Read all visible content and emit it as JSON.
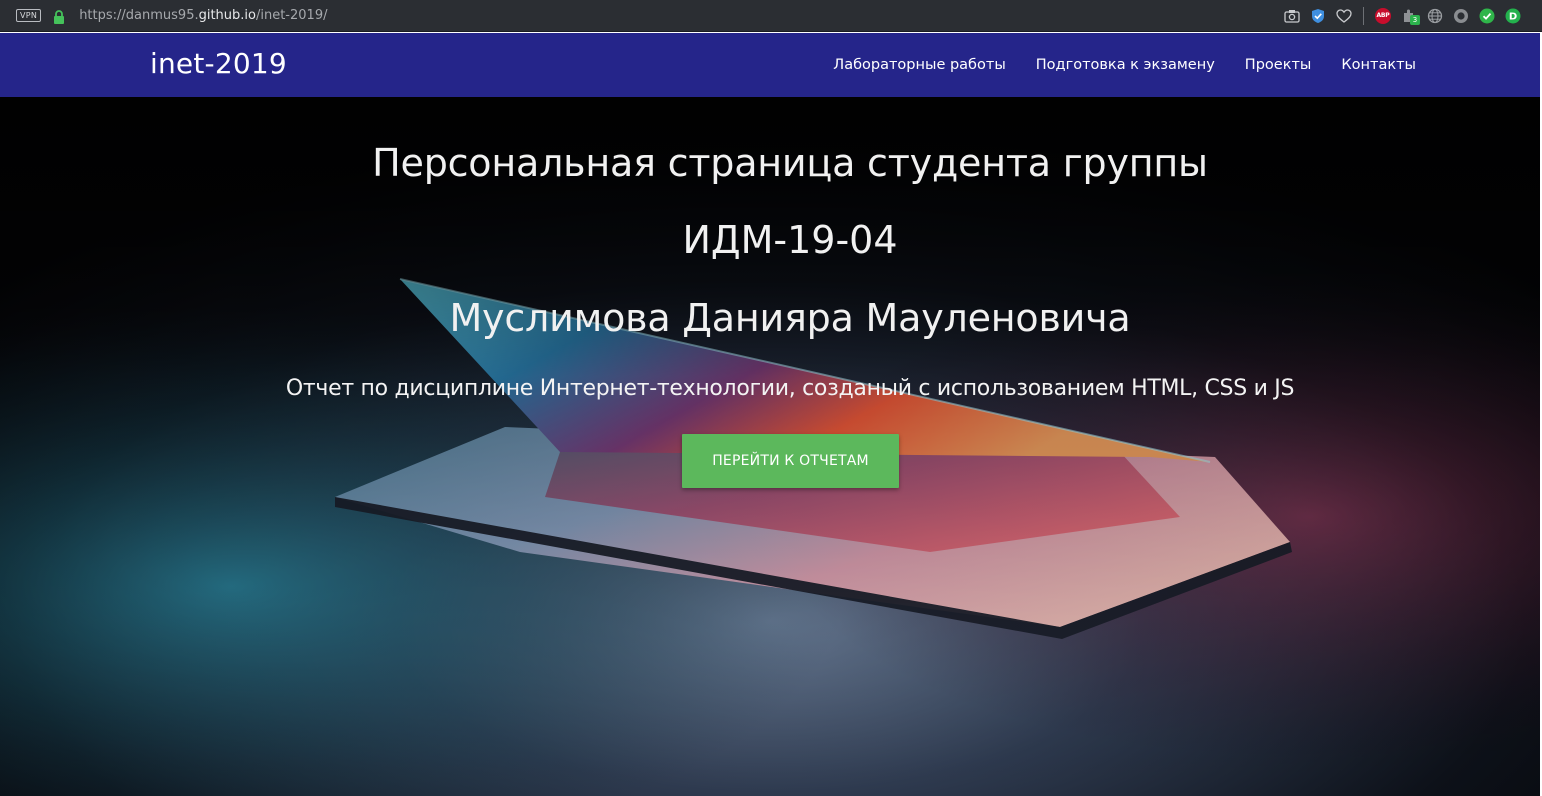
{
  "browser": {
    "vpn_label": "VPN",
    "url_prefix": "https://danmus95.",
    "url_host": "github.io",
    "url_path": "/inet-2019/",
    "extensions": [
      "camera-icon",
      "shield-check-icon",
      "heart-icon",
      "adblock-icon",
      "extension-icon",
      "globe-icon",
      "circle-icon",
      "check-icon",
      "dollar-icon"
    ],
    "adblock_label": "ABP",
    "extension_badge_count": "3"
  },
  "nav": {
    "brand": "inet-2019",
    "links": [
      "Лабораторные работы",
      "Подготовка к экзамену",
      "Проекты",
      "Контакты"
    ],
    "background_color": "#25258a"
  },
  "hero": {
    "title_line1": "Персональная страница студента группы",
    "title_line2": "ИДМ-19-04",
    "title_line3": "Муслимова Данияра Мауленовича",
    "subtitle": "Отчет по дисциплине Интернет-технологии, созданый с использованием HTML, CSS и JS",
    "cta_label": "ПЕРЕЙТИ К ОТЧЕТАМ",
    "cta_color": "#5cb85c"
  }
}
